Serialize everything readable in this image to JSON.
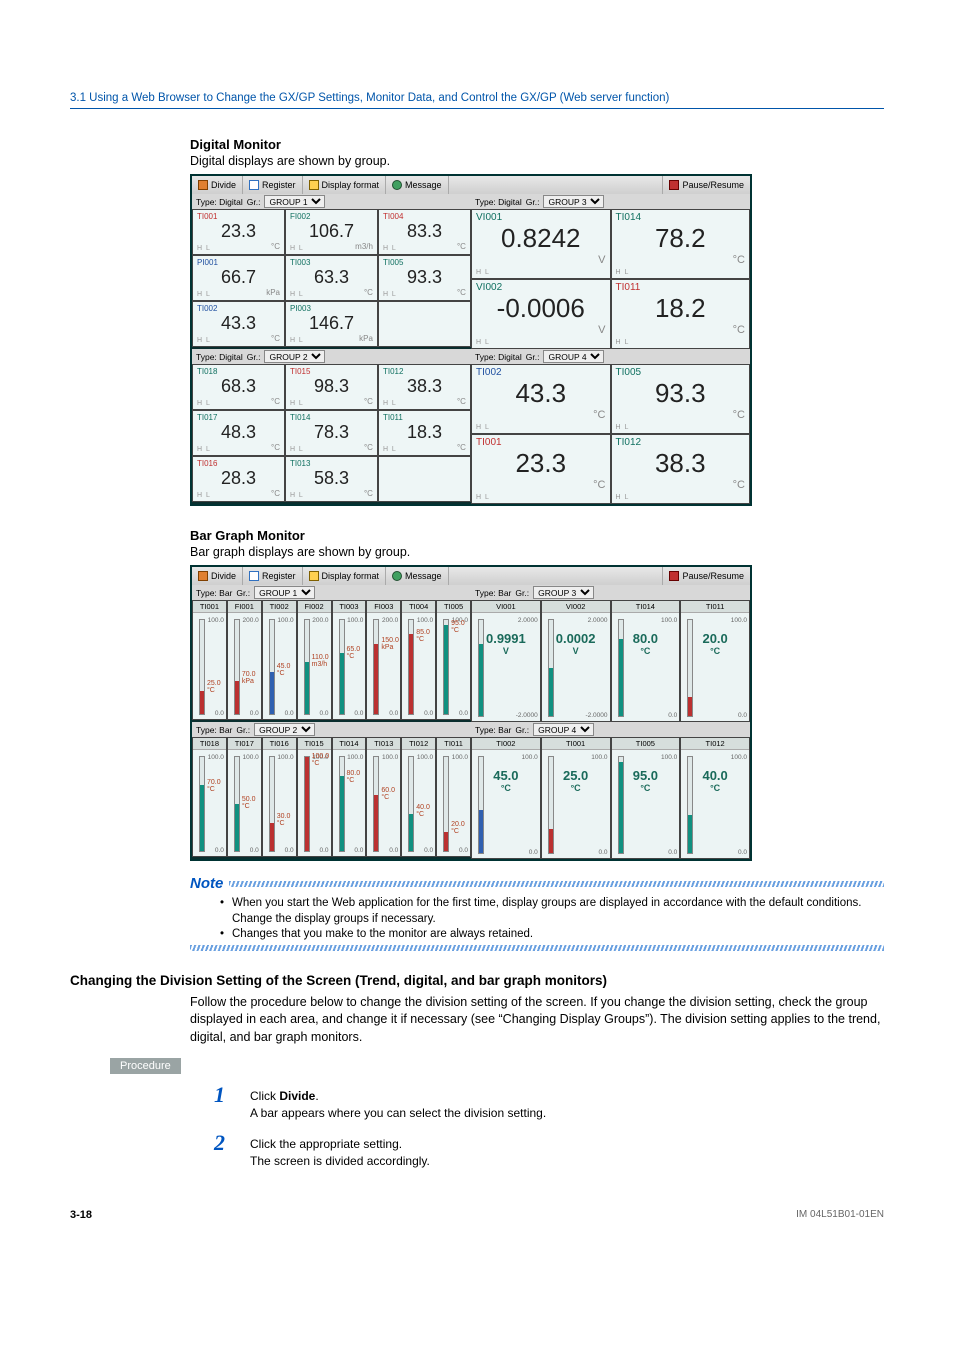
{
  "breadcrumb": "3.1  Using a Web Browser to Change the GX/GP Settings, Monitor Data, and Control the GX/GP (Web server function)",
  "digital": {
    "heading": "Digital Monitor",
    "intro": "Digital displays are shown by group.",
    "toolbar": {
      "divide": "Divide",
      "register": "Register",
      "format": "Display format",
      "message": "Message",
      "pause": "Pause/Resume"
    },
    "areas": [
      {
        "typeLabel": "Type: Digital",
        "grLabel": "Gr.:",
        "group": "GROUP 1",
        "cells": [
          {
            "tag": "TI001",
            "val": "23.3",
            "unit": "°C",
            "cls": "red"
          },
          {
            "tag": "FI002",
            "val": "106.7",
            "unit": "m3/h",
            "cls": "teal"
          },
          {
            "tag": "TI004",
            "val": "83.3",
            "unit": "°C",
            "cls": "red"
          },
          {
            "tag": "PI001",
            "val": "66.7",
            "unit": "kPa",
            "cls": "blue"
          },
          {
            "tag": "TI003",
            "val": "63.3",
            "unit": "°C",
            "cls": "teal"
          },
          {
            "tag": "TI005",
            "val": "93.3",
            "unit": "°C",
            "cls": "teal"
          },
          {
            "tag": "TI002",
            "val": "43.3",
            "unit": "°C",
            "cls": "blue"
          },
          {
            "tag": "PI003",
            "val": "146.7",
            "unit": "kPa",
            "cls": "teal"
          },
          {
            "tag": "",
            "val": "",
            "unit": "",
            "cls": ""
          }
        ]
      },
      {
        "typeLabel": "Type: Digital",
        "grLabel": "Gr.:",
        "group": "GROUP 3",
        "big": true,
        "cells": [
          {
            "tag": "VI001",
            "val": "0.8242",
            "unit": "V",
            "cls": "teal"
          },
          {
            "tag": "TI014",
            "val": "78.2",
            "unit": "°C",
            "cls": "teal"
          },
          {
            "tag": "VI002",
            "val": "-0.0006",
            "unit": "V",
            "cls": "teal"
          },
          {
            "tag": "TI011",
            "val": "18.2",
            "unit": "°C",
            "cls": "red"
          }
        ]
      },
      {
        "typeLabel": "Type: Digital",
        "grLabel": "Gr.:",
        "group": "GROUP 2",
        "cells": [
          {
            "tag": "TI018",
            "val": "68.3",
            "unit": "°C",
            "cls": "teal"
          },
          {
            "tag": "TI015",
            "val": "98.3",
            "unit": "°C",
            "cls": "red"
          },
          {
            "tag": "TI012",
            "val": "38.3",
            "unit": "°C",
            "cls": "teal"
          },
          {
            "tag": "TI017",
            "val": "48.3",
            "unit": "°C",
            "cls": "teal"
          },
          {
            "tag": "TI014",
            "val": "78.3",
            "unit": "°C",
            "cls": "teal"
          },
          {
            "tag": "TI011",
            "val": "18.3",
            "unit": "°C",
            "cls": "teal"
          },
          {
            "tag": "TI016",
            "val": "28.3",
            "unit": "°C",
            "cls": "red"
          },
          {
            "tag": "TI013",
            "val": "58.3",
            "unit": "°C",
            "cls": "teal"
          },
          {
            "tag": "",
            "val": "",
            "unit": "",
            "cls": ""
          }
        ]
      },
      {
        "typeLabel": "Type: Digital",
        "grLabel": "Gr.:",
        "group": "GROUP 4",
        "big": true,
        "cells": [
          {
            "tag": "TI002",
            "val": "43.3",
            "unit": "°C",
            "cls": "blue"
          },
          {
            "tag": "TI005",
            "val": "93.3",
            "unit": "°C",
            "cls": "teal"
          },
          {
            "tag": "TI001",
            "val": "23.3",
            "unit": "°C",
            "cls": "red"
          },
          {
            "tag": "TI012",
            "val": "38.3",
            "unit": "°C",
            "cls": "teal"
          }
        ]
      }
    ]
  },
  "bar": {
    "heading": "Bar Graph Monitor",
    "intro": "Bar graph displays are shown by group.",
    "toolbar": {
      "divide": "Divide",
      "register": "Register",
      "format": "Display format",
      "message": "Message",
      "pause": "Pause/Resume"
    },
    "panels": [
      {
        "typeLabel": "Type: Bar",
        "grLabel": "Gr.:",
        "group": "GROUP 1",
        "cols": [
          {
            "n": "TI001",
            "top": "100.0",
            "bot": "0.0",
            "lab": "25.0",
            "labu": "°C",
            "fill": 25,
            "c": "red"
          },
          {
            "n": "FI001",
            "top": "200.0",
            "bot": "0.0",
            "lab": "70.0",
            "labu": "kPa",
            "fill": 35,
            "c": "red"
          },
          {
            "n": "TI002",
            "top": "100.0",
            "bot": "0.0",
            "lab": "45.0",
            "labu": "°C",
            "fill": 45,
            "c": "blue"
          },
          {
            "n": "FI002",
            "top": "200.0",
            "bot": "0.0",
            "lab": "110.0",
            "labu": "m3/h",
            "fill": 55,
            "c": "teal"
          },
          {
            "n": "TI003",
            "top": "100.0",
            "bot": "0.0",
            "lab": "65.0",
            "labu": "°C",
            "fill": 65,
            "c": "teal"
          },
          {
            "n": "FI003",
            "top": "200.0",
            "bot": "0.0",
            "lab": "150.0",
            "labu": "kPa",
            "fill": 75,
            "c": "red"
          },
          {
            "n": "TI004",
            "top": "100.0",
            "bot": "0.0",
            "lab": "85.0",
            "labu": "°C",
            "fill": 85,
            "c": "red"
          },
          {
            "n": "TI005",
            "top": "100.0",
            "bot": "0.0",
            "lab": "95.0",
            "labu": "°C",
            "fill": 95,
            "c": "teal"
          }
        ]
      },
      {
        "typeLabel": "Type: Bar",
        "grLabel": "Gr.:",
        "group": "GROUP 3",
        "big": true,
        "cols": [
          {
            "n": "VI001",
            "top": "2.0000",
            "bot": "-2.0000",
            "val": "0.9991",
            "u": "V",
            "fill": 75,
            "c": "teal"
          },
          {
            "n": "VI002",
            "top": "2.0000",
            "bot": "-2.0000",
            "val": "0.0002",
            "u": "V",
            "fill": 50,
            "c": "teal"
          },
          {
            "n": "TI014",
            "top": "100.0",
            "bot": "0.0",
            "val": "80.0",
            "u": "°C",
            "fill": 80,
            "c": "teal"
          },
          {
            "n": "TI011",
            "top": "100.0",
            "bot": "0.0",
            "val": "20.0",
            "u": "°C",
            "fill": 20,
            "c": "red"
          }
        ]
      },
      {
        "typeLabel": "Type: Bar",
        "grLabel": "Gr.:",
        "group": "GROUP 2",
        "cols": [
          {
            "n": "TI018",
            "top": "100.0",
            "bot": "0.0",
            "lab": "70.0",
            "labu": "°C",
            "fill": 70,
            "c": "teal"
          },
          {
            "n": "TI017",
            "top": "100.0",
            "bot": "0.0",
            "lab": "50.0",
            "labu": "°C",
            "fill": 50,
            "c": "teal"
          },
          {
            "n": "TI016",
            "top": "100.0",
            "bot": "0.0",
            "lab": "30.0",
            "labu": "°C",
            "fill": 30,
            "c": "red"
          },
          {
            "n": "TI015",
            "top": "100.0",
            "bot": "0.0",
            "lab": "100.0",
            "labu": "°C",
            "fill": 100,
            "c": "red"
          },
          {
            "n": "TI014",
            "top": "100.0",
            "bot": "0.0",
            "lab": "80.0",
            "labu": "°C",
            "fill": 80,
            "c": "teal"
          },
          {
            "n": "TI013",
            "top": "100.0",
            "bot": "0.0",
            "lab": "60.0",
            "labu": "°C",
            "fill": 60,
            "c": "red"
          },
          {
            "n": "TI012",
            "top": "100.0",
            "bot": "0.0",
            "lab": "40.0",
            "labu": "°C",
            "fill": 40,
            "c": "teal"
          },
          {
            "n": "TI011",
            "top": "100.0",
            "bot": "0.0",
            "lab": "20.0",
            "labu": "°C",
            "fill": 20,
            "c": "red"
          }
        ]
      },
      {
        "typeLabel": "Type: Bar",
        "grLabel": "Gr.:",
        "group": "GROUP 4",
        "big": true,
        "cols": [
          {
            "n": "TI002",
            "top": "100.0",
            "bot": "0.0",
            "val": "45.0",
            "u": "°C",
            "fill": 45,
            "c": "blue"
          },
          {
            "n": "TI001",
            "top": "100.0",
            "bot": "0.0",
            "val": "25.0",
            "u": "°C",
            "fill": 25,
            "c": "red"
          },
          {
            "n": "TI005",
            "top": "100.0",
            "bot": "0.0",
            "val": "95.0",
            "u": "°C",
            "fill": 95,
            "c": "teal"
          },
          {
            "n": "TI012",
            "top": "100.0",
            "bot": "0.0",
            "val": "40.0",
            "u": "°C",
            "fill": 40,
            "c": "teal"
          }
        ]
      }
    ]
  },
  "note": {
    "title": "Note",
    "items": [
      "When you start the Web application for the first time, display groups are displayed in accordance with the default conditions. Change the display groups if necessary.",
      "Changes that you make to the monitor are always retained."
    ]
  },
  "changing": {
    "title": "Changing the Division Setting of the Screen (Trend, digital, and bar graph monitors)",
    "para": "Follow the procedure below to change the division setting of the screen. If you change the division setting, check the group displayed in each area, and change it if necessary (see “Changing Display Groups”). The division setting applies to the trend, digital, and bar graph monitors.",
    "procedure": "Procedure",
    "steps": [
      {
        "n": "1",
        "b": "Divide",
        "l1": "Click ",
        "l2": ".",
        "l3": "A bar appears where you can select the division setting."
      },
      {
        "n": "2",
        "b": "",
        "l1": "Click the appropriate setting.",
        "l2": "",
        "l3": "The screen is divided accordingly."
      }
    ]
  },
  "footer": {
    "page": "3-18",
    "doc": "IM 04L51B01-01EN"
  }
}
